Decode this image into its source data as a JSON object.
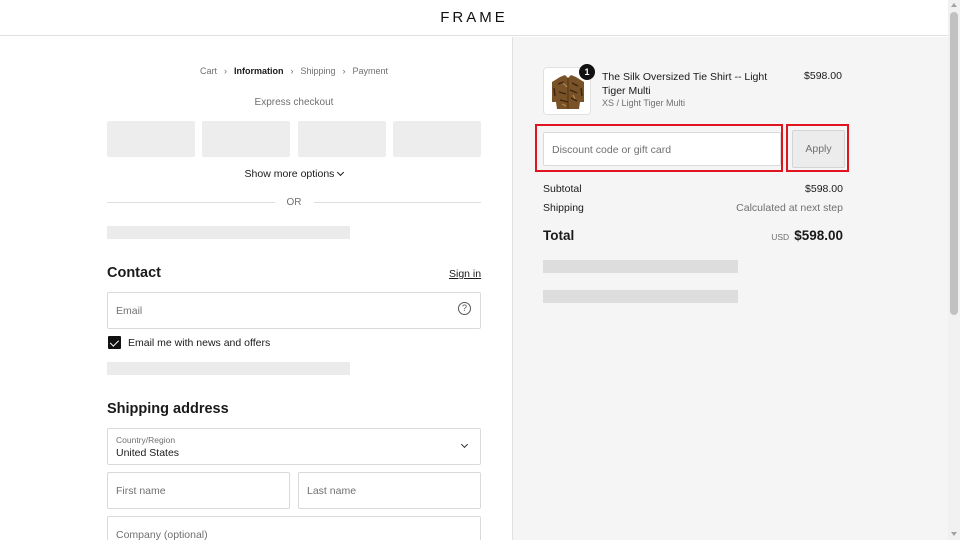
{
  "header": {
    "logo": "FRAME"
  },
  "breadcrumb": {
    "items": [
      {
        "label": "Cart",
        "active": false
      },
      {
        "label": "Information",
        "active": true
      },
      {
        "label": "Shipping",
        "active": false
      },
      {
        "label": "Payment",
        "active": false
      }
    ],
    "separator": "›"
  },
  "express": {
    "title": "Express checkout",
    "show_more": "Show more options",
    "or_label": "OR"
  },
  "contact": {
    "title": "Contact",
    "signin": "Sign in",
    "email_placeholder": "Email",
    "help_icon": "?",
    "newsletter_label": "Email me with news and offers",
    "newsletter_checked": true
  },
  "shipping": {
    "title": "Shipping address",
    "country_label": "Country/Region",
    "country_value": "United States",
    "first_name_placeholder": "First name",
    "last_name_placeholder": "Last name",
    "company_placeholder": "Company (optional)"
  },
  "summary": {
    "product": {
      "name": "The Silk Oversized Tie Shirt -- Light Tiger Multi",
      "variant": "XS / Light Tiger Multi",
      "price": "$598.00",
      "quantity": "1"
    },
    "discount_placeholder": "Discount code or gift card",
    "apply_label": "Apply",
    "subtotal_label": "Subtotal",
    "subtotal_value": "$598.00",
    "shipping_label": "Shipping",
    "shipping_value": "Calculated at next step",
    "total_label": "Total",
    "currency": "USD",
    "total_value": "$598.00"
  },
  "colors": {
    "highlight": "#e0141e",
    "panel_bg": "#f5f5f5",
    "skeleton": "#ebebeb"
  }
}
